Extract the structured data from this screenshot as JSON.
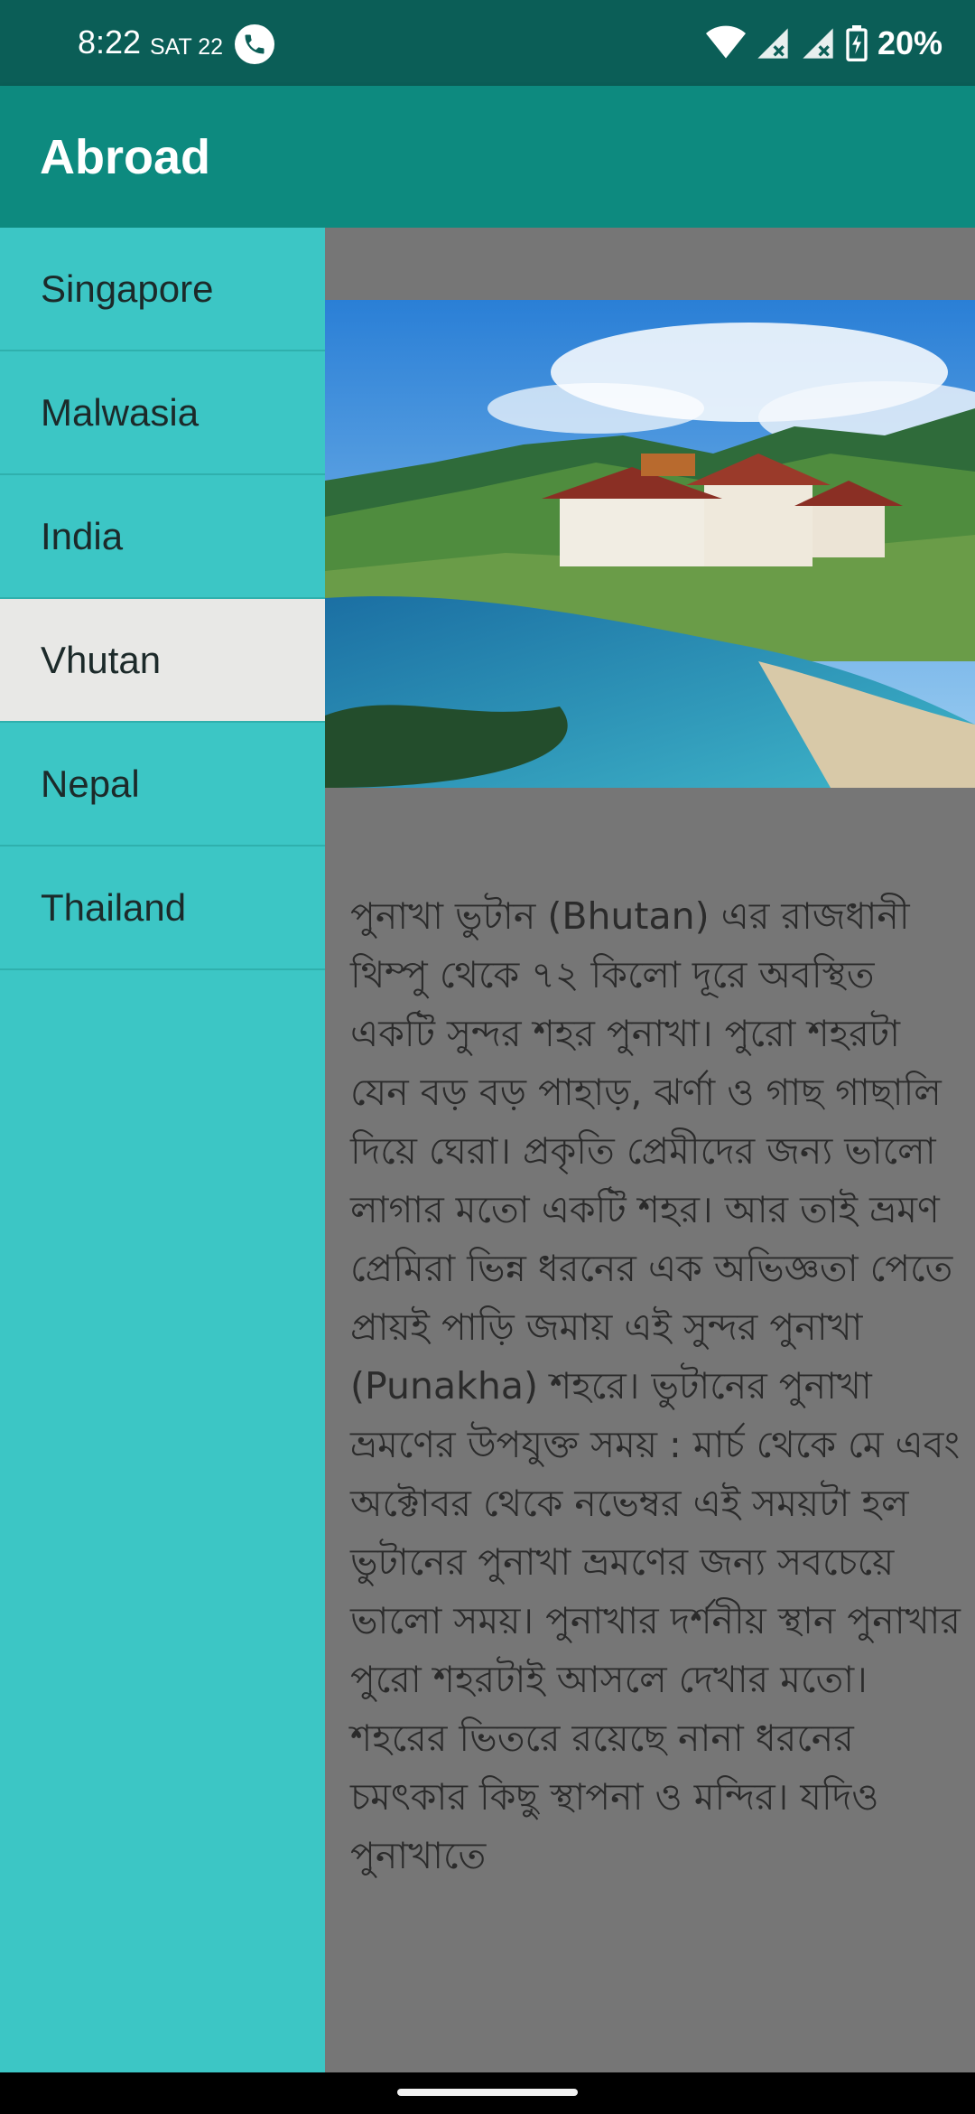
{
  "status_bar": {
    "time": "8:22",
    "date": "SAT 22",
    "battery": "20%",
    "icons": [
      "phone-call-icon",
      "wifi-icon",
      "signal-no-service-icon",
      "signal-no-service-icon",
      "battery-charging-icon"
    ]
  },
  "app_bar": {
    "title": "Abroad"
  },
  "drawer": {
    "items": [
      {
        "label": "Singapore"
      },
      {
        "label": "Malwasia"
      },
      {
        "label": "India"
      },
      {
        "label": "Vhutan"
      },
      {
        "label": "Nepal"
      },
      {
        "label": "Thailand"
      }
    ],
    "selected": "Vhutan"
  },
  "content": {
    "image_description_icon": "punakha-dzong-photo",
    "article_text": "পুনাখা ভুটান (Bhutan) এর রাজধানী থিম্পু থেকে ৭২ কিলো দূরে অবস্থিত একটি সুন্দর শহর পুনাখা। পুরো শহরটা যেন বড় বড় পাহাড়, ঝর্ণা ও গাছ গাছালি দিয়ে ঘেরা। প্রকৃতি প্রেমীদের জন্য ভালো লাগার মতো একটি শহর। আর তাই ভ্রমণ প্রেমিরা ভিন্ন ধরনের এক অভিজ্ঞতা পেতে প্রায়ই পাড়ি জমায় এই সুন্দর পুনাখা (Punakha) শহরে। ভুটানের পুনাখা ভ্রমণের উপযুক্ত সময় : মার্চ থেকে মে এবং অক্টোবর থেকে নভেম্বর এই সময়টা হল ভুটানের পুনাখা ভ্রমণের জন্য সবচেয়ে ভালো সময়। পুনাখার দর্শনীয় স্থান পুনাখার পুরো শহরটাই আসলে দেখার মতো। শহরের ভিতরে রয়েছে নানা ধরনের চমৎকার কিছু স্থাপনা ও মন্দির। যদিও পুনাখাতে"
  },
  "colors": {
    "status_bar": "#0b5e57",
    "app_bar": "#0d8a7f",
    "drawer": "#3cc6c5",
    "drawer_selected": "#e8e8e6",
    "content_bg": "#767676"
  }
}
